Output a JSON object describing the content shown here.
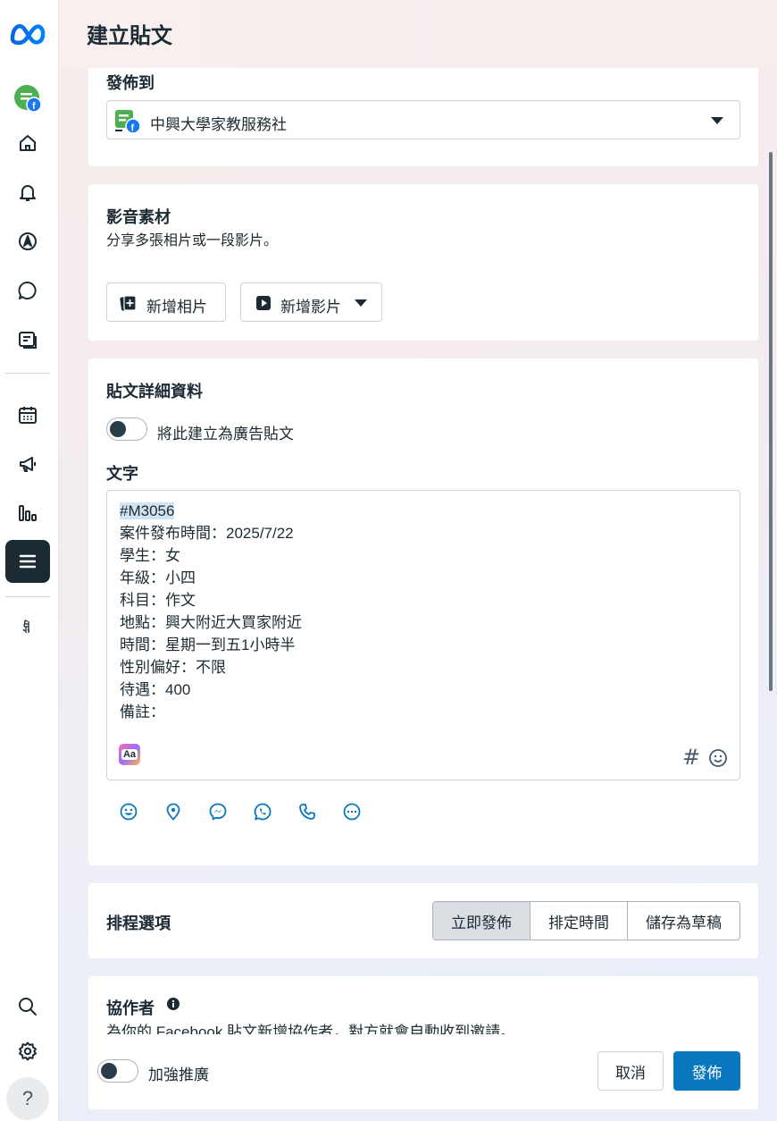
{
  "header": {
    "title": "建立貼文"
  },
  "sidebar": {
    "items": [
      {
        "name": "home",
        "icon": "home-icon"
      },
      {
        "name": "notifications",
        "icon": "bell-icon"
      },
      {
        "name": "explore",
        "icon": "compass-icon"
      },
      {
        "name": "inbox",
        "icon": "chat-bubble-icon"
      },
      {
        "name": "content",
        "icon": "content-icon"
      },
      {
        "name": "planner",
        "icon": "calendar-icon"
      },
      {
        "name": "ads",
        "icon": "megaphone-icon"
      },
      {
        "name": "insights",
        "icon": "bar-chart-icon"
      },
      {
        "name": "all-tools",
        "icon": "menu-icon"
      },
      {
        "name": "custom-tool",
        "icon": "custom-glyph-icon"
      }
    ],
    "bottom": [
      {
        "name": "search",
        "icon": "search-icon"
      },
      {
        "name": "settings",
        "icon": "gear-icon"
      },
      {
        "name": "help",
        "icon": "help-icon",
        "label": "?"
      }
    ]
  },
  "post_to": {
    "title": "發佈到",
    "selected": "中興大學家教服務社"
  },
  "media": {
    "title": "影音素材",
    "subtitle": "分享多張相片或一段影片。",
    "add_photo": "新增相片",
    "add_video": "新增影片"
  },
  "details": {
    "title": "貼文詳細資料",
    "ad_toggle_label": "將此建立為廣告貼文",
    "text_label": "文字",
    "lines": [
      "#M3056",
      "案件發布時間：2025/7/22",
      "學生：女",
      "年級：小四",
      "科目：作文",
      "地點：興大附近大買家附近",
      "時間：星期一到五1小時半",
      "性別偏好：不限",
      "待遇：400",
      "備註："
    ],
    "text_format_badge": "Aa",
    "hashtag_symbol": "#"
  },
  "schedule": {
    "title": "排程選項",
    "options": [
      "立即發佈",
      "排定時間",
      "儲存為草稿"
    ],
    "active_index": 0
  },
  "collaborator": {
    "title": "協作者",
    "subtitle": "為你的 Facebook 貼文新增協作者，對方就會自動收到邀請。"
  },
  "footer": {
    "boost_label": "加強推廣",
    "cancel": "取消",
    "publish": "發佈"
  },
  "colors": {
    "primary": "#0a78be",
    "text": "#1c2b33",
    "facebook": "#1877f2",
    "sidebar_active": "#1c2b33",
    "avatar_green": "#4caf50"
  }
}
